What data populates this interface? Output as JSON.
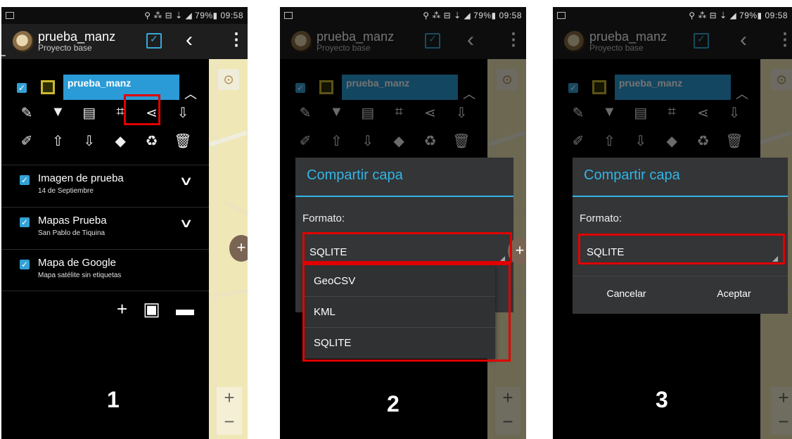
{
  "status": {
    "text": "⚲ ⁂ ⊟ ⇣ ◢ 79%▮ 09:58"
  },
  "app": {
    "title": "prueba_manz",
    "subtitle": "Proyecto base"
  },
  "layer": {
    "name": "prueba_manz"
  },
  "layers": [
    {
      "name": "Imagen de prueba",
      "subtitle": "14 de Septiembre"
    },
    {
      "name": "Mapas Prueba",
      "subtitle": "San Pablo de Tiquina"
    },
    {
      "name": "Mapa de Google",
      "subtitle": "Mapa satélite sin etiquetas"
    }
  ],
  "dialog": {
    "title": "Compartir capa",
    "format_label": "Formato:",
    "selected": "SQLITE",
    "options": [
      "GeoCSV",
      "KML",
      "SQLITE"
    ],
    "cancel": "Cancelar",
    "accept": "Aceptar"
  },
  "steps": [
    "1",
    "2",
    "3"
  ],
  "icons": {
    "toolbar_row1": [
      "edit-icon",
      "filter-icon",
      "list-icon",
      "crop-icon",
      "share-icon",
      "export-icon"
    ],
    "toolbar_row2": [
      "pencil-icon",
      "move-up-icon",
      "move-down-icon",
      "eraser-icon",
      "recycle-icon",
      "trash-icon"
    ],
    "bottom": [
      "add-icon",
      "save-icon",
      "folder-icon"
    ]
  },
  "colors": {
    "accent": "#33b5e5",
    "layer_highlight": "#2a9bd6",
    "callout": "#e10000"
  }
}
